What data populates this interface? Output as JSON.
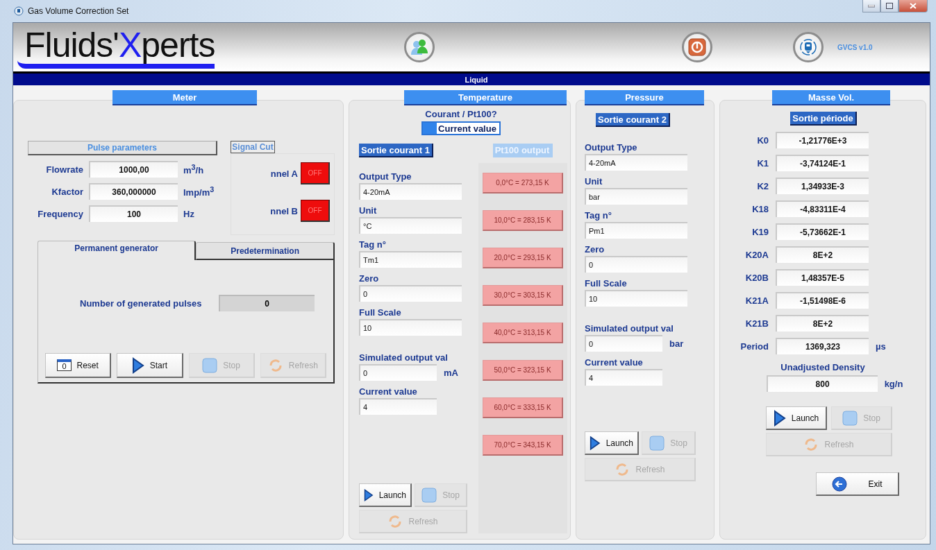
{
  "window": {
    "title": "Gas Volume Correction Set"
  },
  "header": {
    "logo": [
      {
        "text": "Fluids'",
        "accent": false
      },
      {
        "text": "X",
        "accent": true
      },
      {
        "text": "perts",
        "accent": false
      }
    ],
    "version": "GVCS v1.0"
  },
  "mode_band": {
    "title": "Liquid"
  },
  "meter": {
    "title": "Meter",
    "pulse_parameters": {
      "title": "Pulse parameters",
      "fields": [
        {
          "label": "Flowrate",
          "value": "1000,00",
          "unit": "m$^{3}$/h"
        },
        {
          "label": "Kfactor",
          "value": "360,000000",
          "unit": "Imp/m$^{3}$"
        },
        {
          "label": "Frequency",
          "value": "100",
          "unit": "Hz"
        }
      ]
    },
    "signal_cut": {
      "title": "Signal Cut",
      "channels": [
        {
          "label": "nnel A",
          "toggle": "OFF",
          "on": false
        },
        {
          "label": "nnel B",
          "toggle": "OFF",
          "on": false
        }
      ]
    },
    "tabs": [
      {
        "label": "Permanent generator",
        "selected": true
      },
      {
        "label": "Predetermination",
        "selected": false
      }
    ],
    "counter": {
      "label": "Number of generated pulses",
      "value": "0"
    },
    "buttons": [
      {
        "kind": "reset",
        "label": "Reset",
        "badge": "0",
        "disabled": false
      },
      {
        "kind": "start",
        "label": "Start",
        "disabled": false
      },
      {
        "kind": "stop",
        "label": "Stop",
        "disabled": true
      },
      {
        "kind": "refresh",
        "label": "Refresh",
        "disabled": true
      }
    ]
  },
  "temperature": {
    "title": "Temperature",
    "question": "Courant / Pt100?",
    "mode_toggle": {
      "label": "Current value",
      "on": true
    },
    "sections": [
      {
        "label": "Sortie courant 1",
        "selected": true
      },
      {
        "label": "Pt100 output",
        "selected": false
      }
    ],
    "fields": [
      {
        "label": "Output Type",
        "value": "4-20mA"
      },
      {
        "label": "Unit",
        "value": "°C"
      },
      {
        "label": "Tag n°",
        "value": "Tm1"
      },
      {
        "label": "Zero",
        "value": "0"
      },
      {
        "label": "Full Scale",
        "value": "10"
      }
    ],
    "simulated": {
      "label": "Simulated output val",
      "value": "0",
      "unit": "mA"
    },
    "current": {
      "label": "Current value",
      "value": "4"
    },
    "pt100_buttons": [
      {
        "label": "0,0°C = 273,15 K",
        "disabled": true
      },
      {
        "label": "10,0°C = 283,15 K",
        "disabled": true
      },
      {
        "label": "20,0°C = 293,15 K",
        "disabled": true
      },
      {
        "label": "30,0°C = 303,15 K",
        "disabled": true
      },
      {
        "label": "40,0°C = 313,15 K",
        "disabled": true
      },
      {
        "label": "50,0°C = 323,15 K",
        "disabled": true
      },
      {
        "label": "60,0°C = 333,15 K",
        "disabled": true
      },
      {
        "label": "70,0°C = 343,15 K",
        "disabled": true
      }
    ],
    "buttons": [
      {
        "kind": "launch",
        "label": "Launch",
        "disabled": false
      },
      {
        "kind": "stop",
        "label": "Stop",
        "disabled": true
      },
      {
        "kind": "refresh",
        "label": "Refresh",
        "disabled": true
      }
    ]
  },
  "pressure": {
    "title": "Pressure",
    "section": {
      "label": "Sortie courant 2",
      "selected": true
    },
    "fields": [
      {
        "label": "Output Type",
        "value": "4-20mA"
      },
      {
        "label": "Unit",
        "value": "bar"
      },
      {
        "label": "Tag n°",
        "value": "Pm1"
      },
      {
        "label": "Zero",
        "value": "0"
      },
      {
        "label": "Full Scale",
        "value": "10"
      }
    ],
    "simulated": {
      "label": "Simulated output val",
      "value": "0",
      "unit": "bar"
    },
    "current": {
      "label": "Current value",
      "value": "4"
    },
    "buttons": [
      {
        "kind": "launch",
        "label": "Launch",
        "disabled": false
      },
      {
        "kind": "stop",
        "label": "Stop",
        "disabled": true
      },
      {
        "kind": "refresh",
        "label": "Refresh",
        "disabled": true
      }
    ]
  },
  "density": {
    "title": "Masse Vol.",
    "section": {
      "label": "Sortie période",
      "selected": true
    },
    "coefficients": [
      {
        "label": "K0",
        "value": "-1,21776E+3"
      },
      {
        "label": "K1",
        "value": "-3,74124E-1"
      },
      {
        "label": "K2",
        "value": "1,34933E-3"
      },
      {
        "label": "K18",
        "value": "-4,83311E-4"
      },
      {
        "label": "K19",
        "value": "-5,73662E-1"
      },
      {
        "label": "K20A",
        "value": "8E+2"
      },
      {
        "label": "K20B",
        "value": "1,48357E-5"
      },
      {
        "label": "K21A",
        "value": "-1,51498E-6"
      },
      {
        "label": "K21B",
        "value": "8E+2"
      }
    ],
    "period": {
      "label": "Period",
      "value": "1369,323",
      "unit": "µs"
    },
    "unadjusted": {
      "label": "Unadjusted Density",
      "value": "800",
      "unit": "kg/n"
    },
    "buttons": [
      {
        "kind": "launch",
        "label": "Launch",
        "disabled": false
      },
      {
        "kind": "stop",
        "label": "Stop",
        "disabled": true
      },
      {
        "kind": "refresh",
        "label": "Refresh",
        "disabled": true
      }
    ],
    "exit": {
      "label": "Exit"
    }
  }
}
